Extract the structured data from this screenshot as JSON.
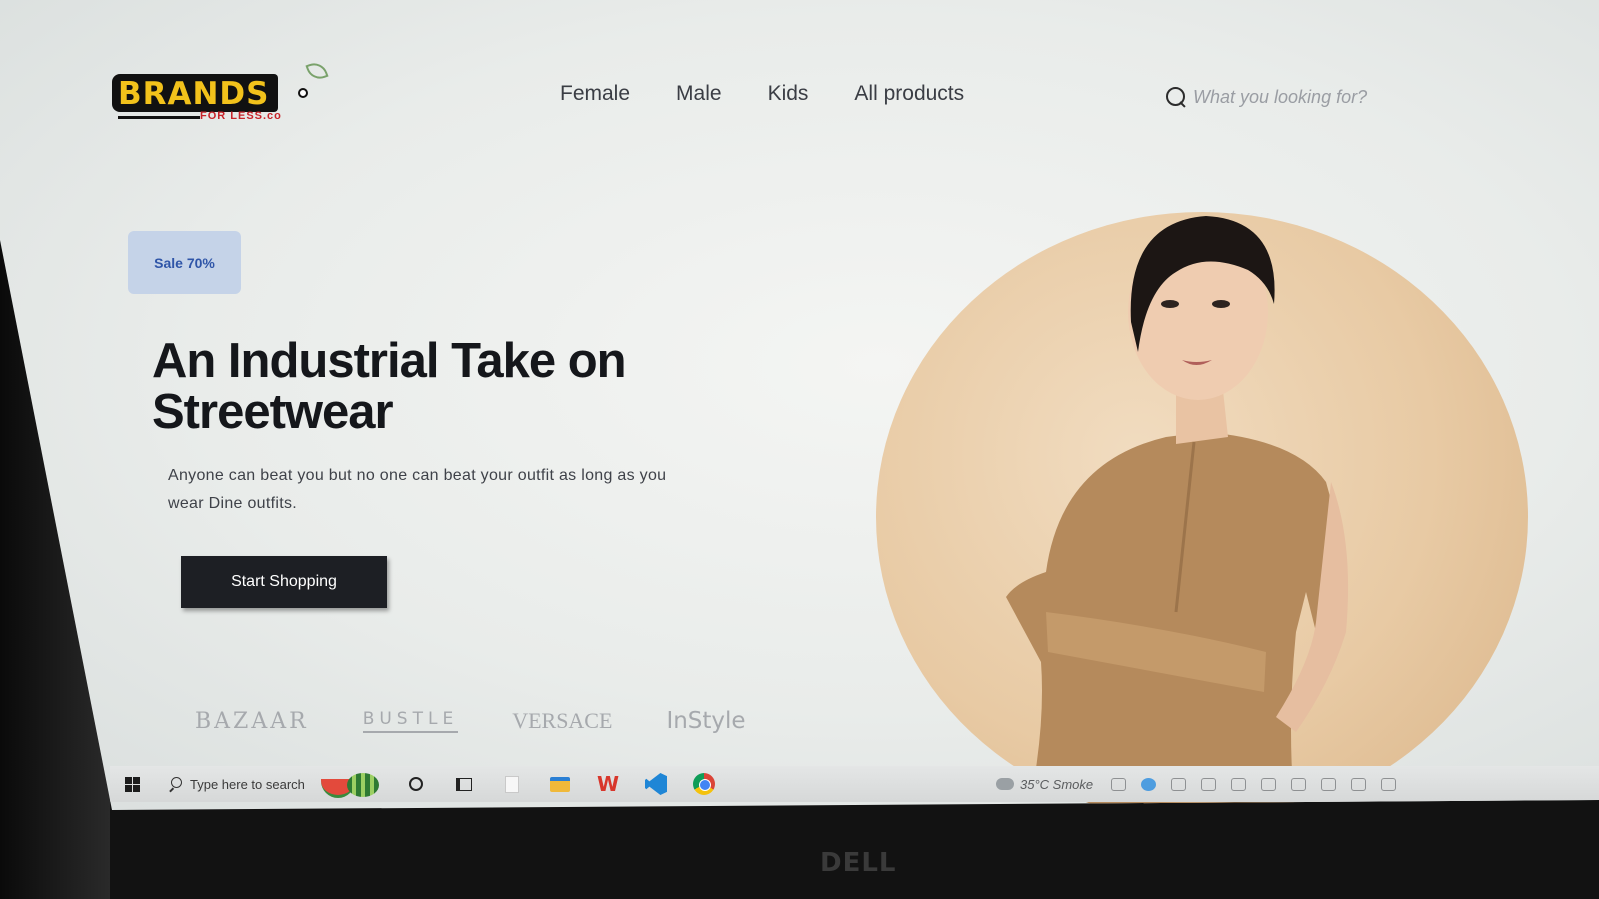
{
  "logo": {
    "main": "BRANDS",
    "sub": "FOR LESS.co"
  },
  "nav": {
    "items": [
      "Female",
      "Male",
      "Kids",
      "All products"
    ]
  },
  "search": {
    "placeholder": "What you looking for?"
  },
  "hero": {
    "badge": "Sale 70%",
    "title_line1": "An Industrial Take on",
    "title_line2": "Streetwear",
    "subtitle": "Anyone can beat you but no one can beat your outfit as long as you wear Dine outfits.",
    "cta": "Start Shopping"
  },
  "brands": [
    "BAZAAR",
    "BUSTLE",
    "VERSACE",
    "InStyle"
  ],
  "taskbar": {
    "search_placeholder": "Type here to search",
    "weather": "35°C Smoke",
    "icons": [
      "windows-start-icon",
      "search-icon",
      "watermelon-icon",
      "cortana-icon",
      "task-view-icon",
      "file-icon",
      "file-explorer-icon",
      "wps-office-icon",
      "vscode-icon",
      "chrome-icon"
    ]
  },
  "monitor": {
    "brand": "DELL"
  },
  "colors": {
    "logo_yellow": "#f2c21b",
    "logo_red": "#c8242a",
    "badge_bg": "#c5d3e8",
    "badge_text": "#2f55a8",
    "cta_bg": "#1d1f24",
    "hero_circle": "#e8caa4"
  }
}
